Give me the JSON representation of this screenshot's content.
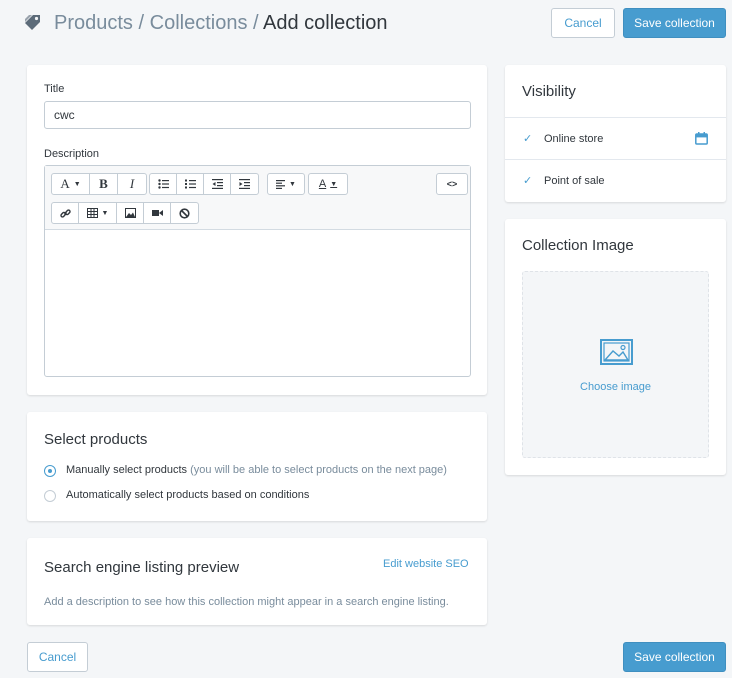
{
  "header": {
    "breadcrumb_root": "Products",
    "separator": "/",
    "breadcrumb_parent": "Collections",
    "breadcrumb_current": "Add collection",
    "cancel_label": "Cancel",
    "save_label": "Save collection"
  },
  "details": {
    "title_label": "Title",
    "title_value": "cwc",
    "description_label": "Description",
    "toolbar": {
      "font_glyph": "A",
      "bold_glyph": "B",
      "italic_glyph": "I",
      "text_color_glyph": "A",
      "html_glyph": "<>"
    }
  },
  "select_products": {
    "title": "Select products",
    "manual_label": "Manually select products",
    "manual_hint": "(you will be able to select products on the next page)",
    "auto_label": "Automatically select products based on conditions",
    "selected": "manual"
  },
  "seo": {
    "title": "Search engine listing preview",
    "edit_link": "Edit website SEO",
    "description": "Add a description to see how this collection might appear in a search engine listing."
  },
  "visibility": {
    "title": "Visibility",
    "channels": [
      {
        "label": "Online store",
        "checked": true
      },
      {
        "label": "Point of sale",
        "checked": true
      }
    ]
  },
  "collection_image": {
    "title": "Collection Image",
    "choose_label": "Choose image"
  },
  "footer": {
    "cancel_label": "Cancel",
    "save_label": "Save collection"
  },
  "colors": {
    "accent": "#479ccf",
    "background": "#f4f6f8",
    "text": "#31373d",
    "muted": "#798c9c"
  }
}
